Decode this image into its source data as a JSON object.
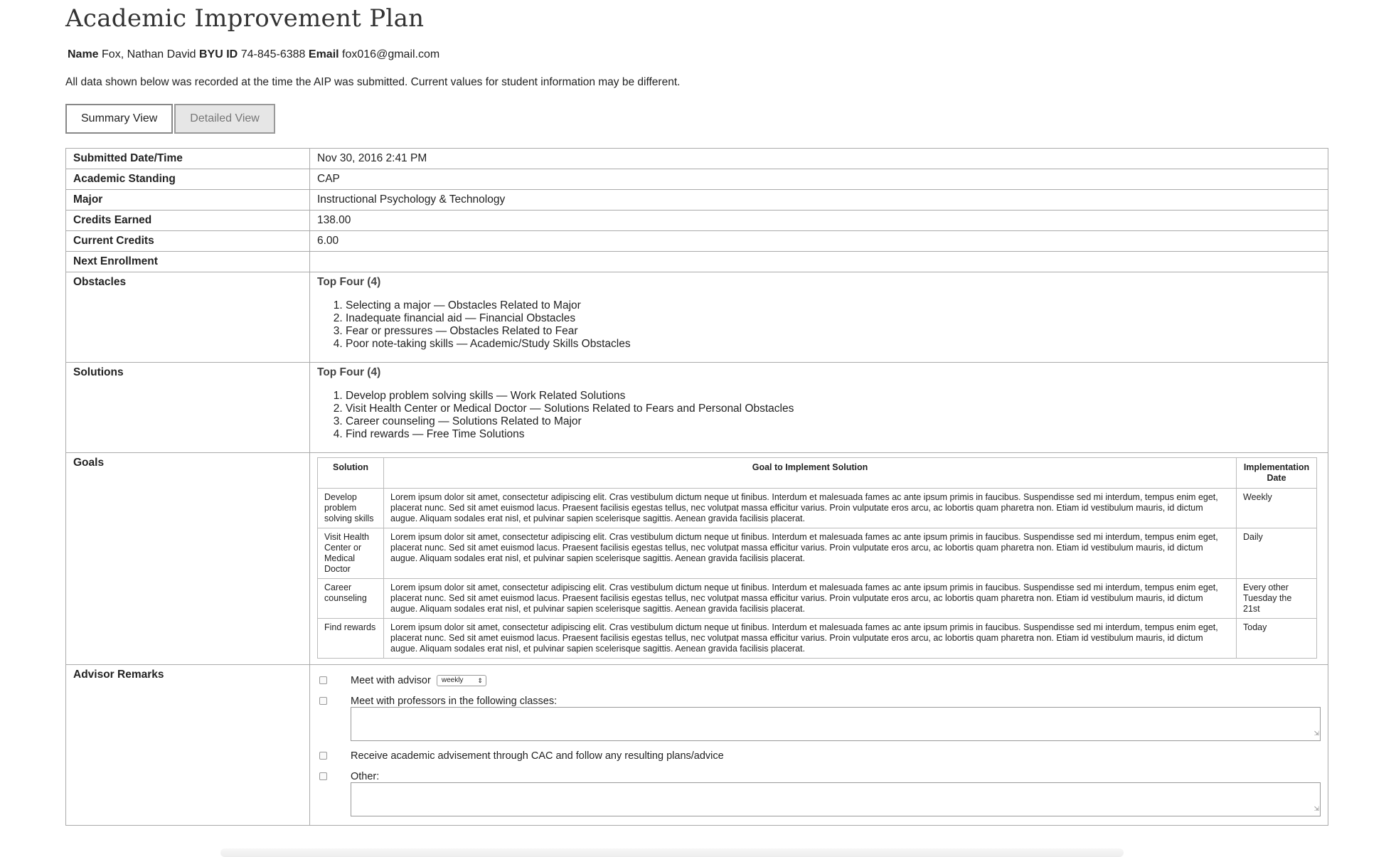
{
  "title": "Academic Improvement Plan",
  "student": {
    "name_label": "Name",
    "name": "Fox, Nathan David",
    "id_label": "BYU ID",
    "id": "74-845-6388",
    "email_label": "Email",
    "email": "fox016@gmail.com"
  },
  "notice": "All data shown below was recorded at the time the AIP was submitted. Current values for student information may be different.",
  "views": {
    "summary": "Summary View",
    "detailed": "Detailed View"
  },
  "fields": {
    "submitted": {
      "label": "Submitted Date/Time",
      "value": "Nov 30, 2016 2:41 PM"
    },
    "standing": {
      "label": "Academic Standing",
      "value": "CAP"
    },
    "major": {
      "label": "Major",
      "value": "Instructional Psychology & Technology"
    },
    "credits_earned": {
      "label": "Credits Earned",
      "value": "138.00"
    },
    "current_credits": {
      "label": "Current Credits",
      "value": "6.00"
    },
    "next_enrollment": {
      "label": "Next Enrollment",
      "value": ""
    }
  },
  "obstacles": {
    "label": "Obstacles",
    "heading": "Top Four (4)",
    "items": [
      "Selecting a major — Obstacles Related to Major",
      "Inadequate financial aid — Financial Obstacles",
      "Fear or pressures — Obstacles Related to Fear",
      "Poor note-taking skills — Academic/Study Skills Obstacles"
    ]
  },
  "solutions": {
    "label": "Solutions",
    "heading": "Top Four (4)",
    "items": [
      "Develop problem solving skills — Work Related Solutions",
      "Visit Health Center or Medical Doctor — Solutions Related to Fears and Personal Obstacles",
      "Career counseling — Solutions Related to Major",
      "Find rewards — Free Time Solutions"
    ]
  },
  "goals": {
    "label": "Goals",
    "headers": {
      "solution": "Solution",
      "goal": "Goal to Implement Solution",
      "date": "Implementation Date"
    },
    "rows": [
      {
        "solution": "Develop problem solving skills",
        "goal": "Lorem ipsum dolor sit amet, consectetur adipiscing elit. Cras vestibulum dictum neque ut finibus. Interdum et malesuada fames ac ante ipsum primis in faucibus. Suspendisse sed mi interdum, tempus enim eget, placerat nunc. Sed sit amet euismod lacus. Praesent facilisis egestas tellus, nec volutpat massa efficitur varius. Proin vulputate eros arcu, ac lobortis quam pharetra non. Etiam id vestibulum mauris, id dictum augue. Aliquam sodales erat nisl, et pulvinar sapien scelerisque sagittis. Aenean gravida facilisis placerat.",
        "date": "Weekly"
      },
      {
        "solution": "Visit Health Center or Medical Doctor",
        "goal": "Lorem ipsum dolor sit amet, consectetur adipiscing elit. Cras vestibulum dictum neque ut finibus. Interdum et malesuada fames ac ante ipsum primis in faucibus. Suspendisse sed mi interdum, tempus enim eget, placerat nunc. Sed sit amet euismod lacus. Praesent facilisis egestas tellus, nec volutpat massa efficitur varius. Proin vulputate eros arcu, ac lobortis quam pharetra non. Etiam id vestibulum mauris, id dictum augue. Aliquam sodales erat nisl, et pulvinar sapien scelerisque sagittis. Aenean gravida facilisis placerat.",
        "date": "Daily"
      },
      {
        "solution": "Career counseling",
        "goal": "Lorem ipsum dolor sit amet, consectetur adipiscing elit. Cras vestibulum dictum neque ut finibus. Interdum et malesuada fames ac ante ipsum primis in faucibus. Suspendisse sed mi interdum, tempus enim eget, placerat nunc. Sed sit amet euismod lacus. Praesent facilisis egestas tellus, nec volutpat massa efficitur varius. Proin vulputate eros arcu, ac lobortis quam pharetra non. Etiam id vestibulum mauris, id dictum augue. Aliquam sodales erat nisl, et pulvinar sapien scelerisque sagittis. Aenean gravida facilisis placerat.",
        "date": "Every other Tuesday the 21st"
      },
      {
        "solution": "Find rewards",
        "goal": "Lorem ipsum dolor sit amet, consectetur adipiscing elit. Cras vestibulum dictum neque ut finibus. Interdum et malesuada fames ac ante ipsum primis in faucibus. Suspendisse sed mi interdum, tempus enim eget, placerat nunc. Sed sit amet euismod lacus. Praesent facilisis egestas tellus, nec volutpat massa efficitur varius. Proin vulputate eros arcu, ac lobortis quam pharetra non. Etiam id vestibulum mauris, id dictum augue. Aliquam sodales erat nisl, et pulvinar sapien scelerisque sagittis. Aenean gravida facilisis placerat.",
        "date": "Today"
      }
    ]
  },
  "remarks": {
    "label": "Advisor Remarks",
    "meet_advisor": "Meet with advisor",
    "frequency": "weekly",
    "meet_professors": "Meet with professors in the following classes:",
    "advisement": "Receive academic advisement through CAC and follow any resulting plans/advice",
    "other": "Other:"
  }
}
